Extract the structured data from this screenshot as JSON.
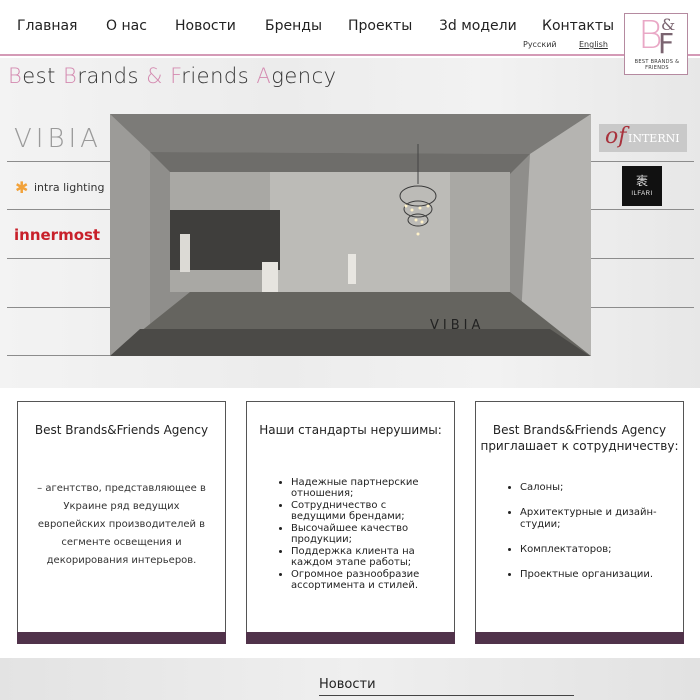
{
  "nav": {
    "items": [
      "Главная",
      "О нас",
      "Новости",
      "Бренды",
      "Проекты",
      "3d модели",
      "Контакты"
    ],
    "languages": [
      "Русский",
      "English"
    ]
  },
  "logo": {
    "letters": [
      "B",
      "&",
      "F"
    ],
    "caption": "BEST BRANDS & FRIENDS"
  },
  "site_title": {
    "parts": [
      "B",
      "est ",
      "B",
      "rands ",
      "&",
      " ",
      "F",
      "riends ",
      "A",
      "gency"
    ]
  },
  "brands": {
    "left": [
      "VIBIA",
      "intra lighting",
      "innermost"
    ],
    "right_interni": {
      "mark": "of",
      "text": "INTERNI"
    },
    "right_ilfari": {
      "mark": "袠",
      "text": "ILFARI"
    },
    "hero_label": "VIBIA"
  },
  "cards": [
    {
      "title": "Best Brands&Friends Agency",
      "text": "– агентство, представляющее в Украине ряд ведущих европейских производителей в сегменте освещения и декорирования интерьеров."
    },
    {
      "title": "Наши стандарты нерушимы:",
      "items": [
        "Надежные партнерские отношения;",
        "Сотрудничество с ведущими брендами;",
        "Высочайшее качество продукции;",
        "Поддержка клиента на каждом этапе работы;",
        "Огромное разнообразие ассортимента и стилей."
      ]
    },
    {
      "title": "Best Brands&Friends Agency приглашает к сотрудничеству:",
      "items": [
        "Салоны;",
        "Архитектурные и дизайн-студии;",
        "Комплектаторов;",
        "Проектные организации."
      ]
    }
  ],
  "news": {
    "heading": "Новости"
  },
  "colors": {
    "accent_pink": "#d49ab6",
    "card_bar": "#50324a",
    "innermost_red": "#c8202a"
  }
}
